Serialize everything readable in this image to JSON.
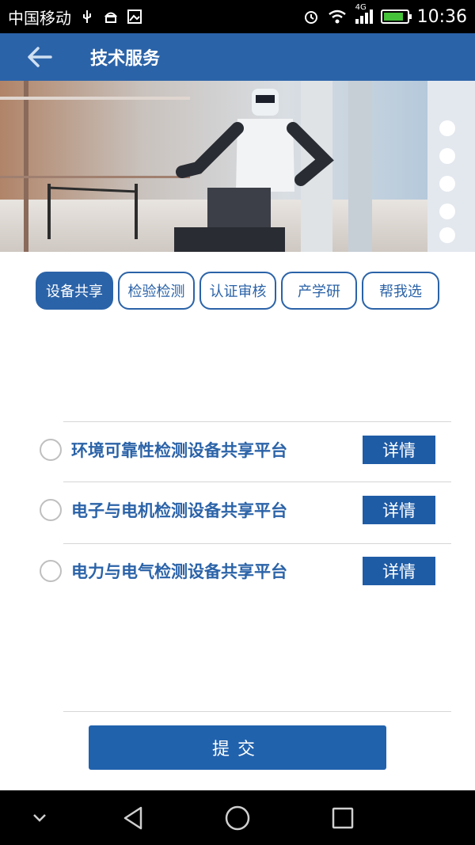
{
  "status_bar": {
    "carrier": "中国移动",
    "network": "4G",
    "time": "10:36"
  },
  "app_bar": {
    "title": "技术服务",
    "back_icon": "arrow-left-icon"
  },
  "tabs": [
    {
      "label": "设备共享",
      "active": true
    },
    {
      "label": "检验检测",
      "active": false
    },
    {
      "label": "认证审核",
      "active": false
    },
    {
      "label": "产学研",
      "active": false
    },
    {
      "label": "帮我选",
      "active": false
    }
  ],
  "platforms": [
    {
      "label": "环境可靠性检测设备共享平台",
      "button": "详情",
      "selected": false
    },
    {
      "label": "电子与电机检测设备共享平台",
      "button": "详情",
      "selected": false
    },
    {
      "label": "电力与电气检测设备共享平台",
      "button": "详情",
      "selected": false
    }
  ],
  "submit_label": "提交",
  "colors": {
    "primary": "#2b63a8",
    "button": "#1f5ca6",
    "divider": "#d6d6d6"
  }
}
